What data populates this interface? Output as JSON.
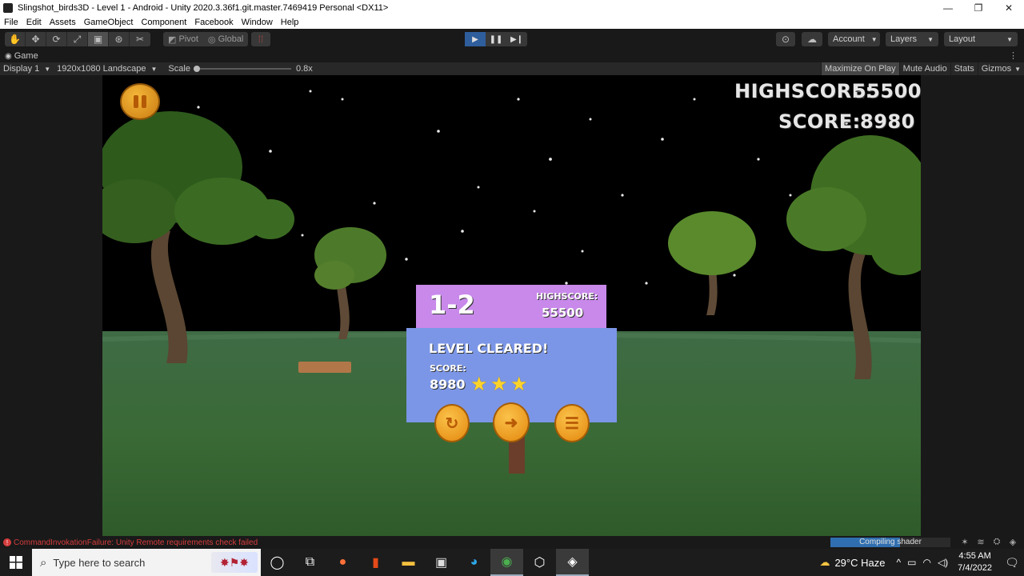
{
  "window": {
    "title": "Slingshot_birds3D - Level 1 - Android - Unity 2020.3.36f1.git.master.7469419 Personal <DX11>",
    "minimize": "—",
    "restore": "❐",
    "close": "✕"
  },
  "menu": [
    "File",
    "Edit",
    "Assets",
    "GameObject",
    "Component",
    "Facebook",
    "Window",
    "Help"
  ],
  "toolbar": {
    "pivot_label": "Pivot",
    "global_label": "Global",
    "account_label": "Account",
    "layers_label": "Layers",
    "layout_label": "Layout",
    "play_mode": "playing"
  },
  "game_view": {
    "tab_label": "Game",
    "display": "Display 1",
    "resolution": "1920x1080 Landscape",
    "scale_label": "Scale",
    "scale_value": "0.8x",
    "maximize_on_play": "Maximize On Play",
    "mute_audio": "Mute Audio",
    "stats": "Stats",
    "gizmos": "Gizmos"
  },
  "hud": {
    "highscore_label": "HIGHSCORE:",
    "highscore_value": "55500",
    "score_label": "SCORE:",
    "score_value": "8980"
  },
  "level_panel": {
    "level": "1-2",
    "highscore_label": "HIGHSCORE:",
    "highscore_value": "55500",
    "status": "LEVEL CLEARED!",
    "score_label": "SCORE:",
    "score_value": "8980",
    "stars_earned": 3,
    "stars_total": 3,
    "star_color": "#ffd42a",
    "top_color": "#c889ea",
    "main_color": "#7b96e6"
  },
  "status": {
    "error": "CommandInvokationFailure: Unity Remote requirements check failed",
    "progress_label": "Compiling shader",
    "progress_fraction": 0.58
  },
  "taskbar": {
    "search_placeholder": "Type here to search",
    "weather": "29°C Haze",
    "time": "4:55 AM",
    "date": "7/4/2022"
  }
}
